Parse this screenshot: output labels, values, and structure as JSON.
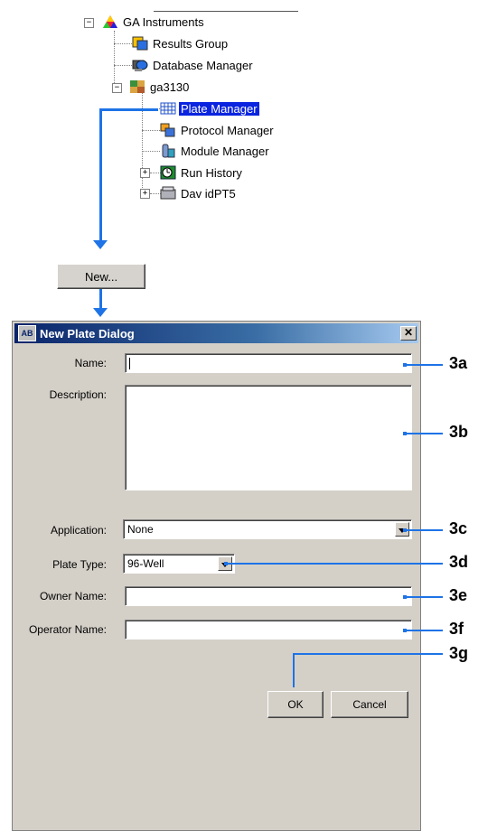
{
  "tree": {
    "root": {
      "label": "GA Instruments",
      "expander": "−"
    },
    "results_group": {
      "label": "Results Group"
    },
    "database_manager": {
      "label": "Database Manager"
    },
    "instrument": {
      "label": "ga3130",
      "expander": "−"
    },
    "plate_manager": {
      "label": "Plate Manager",
      "selected": true
    },
    "protocol_manager": {
      "label": "Protocol Manager"
    },
    "module_manager": {
      "label": "Module Manager"
    },
    "run_history": {
      "label": "Run History",
      "expander": "+"
    },
    "device": {
      "label": "Dav idPT5",
      "expander": "+"
    }
  },
  "new_button": {
    "label": "New..."
  },
  "dialog": {
    "title": "New Plate Dialog",
    "close_label": "✕",
    "fields": {
      "name": {
        "label": "Name:",
        "value": ""
      },
      "description": {
        "label": "Description:",
        "value": ""
      },
      "application": {
        "label": "Application:",
        "value": "None"
      },
      "plate_type": {
        "label": "Plate Type:",
        "value": "96-Well"
      },
      "owner_name": {
        "label": "Owner Name:",
        "value": ""
      },
      "operator_name": {
        "label": "Operator Name:",
        "value": ""
      }
    },
    "ok_label": "OK",
    "cancel_label": "Cancel"
  },
  "callouts": [
    "3a",
    "3b",
    "3c",
    "3d",
    "3e",
    "3f",
    "3g"
  ],
  "colors": {
    "accent": "#1e73e6",
    "selection": "#0a24e0",
    "dialog_bg": "#d4d0c8",
    "titlebar": "#0a246a"
  }
}
